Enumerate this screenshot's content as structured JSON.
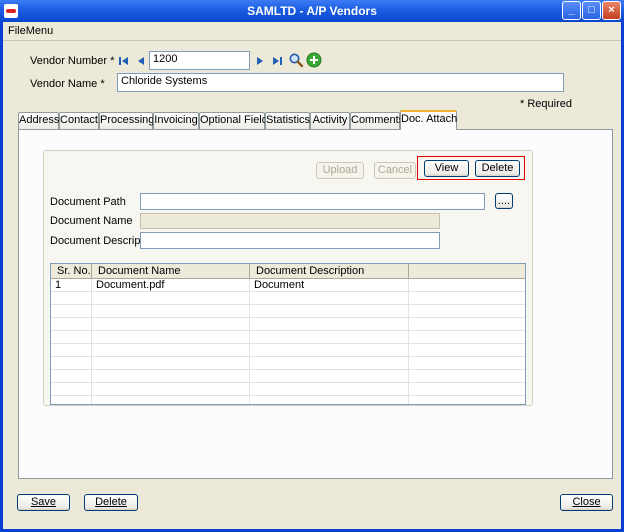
{
  "window": {
    "title": "SAMLTD - A/P Vendors",
    "min_glyph": "_",
    "max_glyph": "□",
    "close_glyph": "×"
  },
  "menu": {
    "file_label": "FileMenu"
  },
  "vendor": {
    "number_label": "Vendor Number *",
    "number_value": "1200",
    "name_label": "Vendor Name *",
    "name_value": "Chloride Systems",
    "required_note": "* Required"
  },
  "tabs": [
    "Address",
    "Contact",
    "Processing",
    "Invoicing",
    "Optional Fields",
    "Statistics",
    "Activity",
    "Comments",
    "Doc. Attach"
  ],
  "active_tab": "Doc. Attach",
  "doc": {
    "upload_label": "Upload",
    "cancel_label": "Cancel",
    "view_label": "View",
    "delete_label": "Delete",
    "path_label": "Document Path",
    "path_value": "",
    "name_label": "Document Name",
    "name_value": "",
    "desc_label": "Document Description",
    "desc_value": "",
    "browse_label": "...."
  },
  "grid": {
    "columns": [
      "Sr. No.",
      "Document Name",
      "Document Description",
      ""
    ],
    "rows": [
      [
        "1",
        "Document.pdf",
        "Document",
        ""
      ],
      [
        "",
        "",
        "",
        ""
      ],
      [
        "",
        "",
        "",
        ""
      ],
      [
        "",
        "",
        "",
        ""
      ],
      [
        "",
        "",
        "",
        ""
      ],
      [
        "",
        "",
        "",
        ""
      ],
      [
        "",
        "",
        "",
        ""
      ],
      [
        "",
        "",
        "",
        ""
      ],
      [
        "",
        "",
        "",
        ""
      ],
      [
        "",
        "",
        "",
        ""
      ]
    ]
  },
  "footer": {
    "save_label": "Save",
    "delete_label": "Delete",
    "close_label": "Close"
  },
  "colors": {
    "title_bar": "#0a46d0",
    "dialog_bg": "#ece9d8",
    "highlight": "#e00000",
    "add_icon": "#3aa834"
  }
}
